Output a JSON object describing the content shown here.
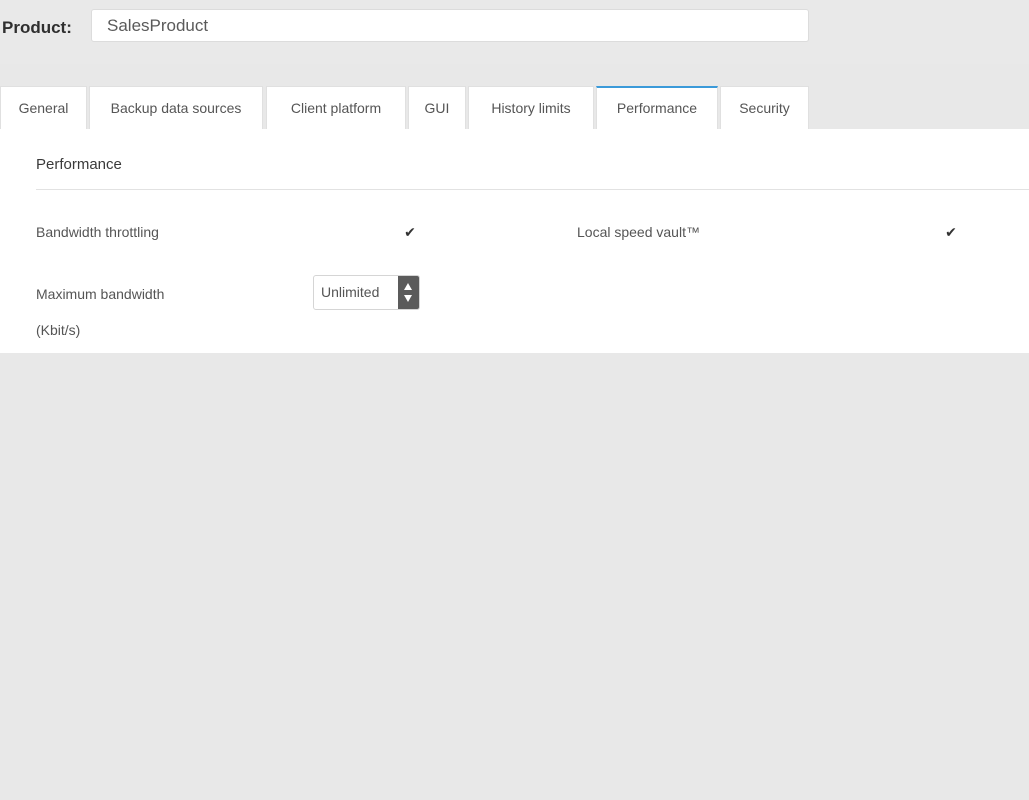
{
  "header": {
    "product_label": "Product:",
    "product_value": "SalesProduct"
  },
  "tabs": [
    {
      "label": "General",
      "active": false
    },
    {
      "label": "Backup data sources",
      "active": false
    },
    {
      "label": "Client platform",
      "active": false
    },
    {
      "label": "GUI",
      "active": false
    },
    {
      "label": "History limits",
      "active": false
    },
    {
      "label": "Performance",
      "active": true
    },
    {
      "label": "Security",
      "active": false
    }
  ],
  "panel": {
    "title": "Performance",
    "bandwidth_throttling": {
      "label": "Bandwidth throttling",
      "checked": true
    },
    "local_speed_vault": {
      "label": "Local speed vault™",
      "checked": true
    },
    "maximum_bandwidth": {
      "label": "Maximum bandwidth",
      "unit": "(Kbit/s)",
      "value": "Unlimited"
    }
  },
  "colors": {
    "accent": "#3b9ad9",
    "background": "#e8e8e8",
    "panel": "#ffffff",
    "stepper_button": "#5b5b5b"
  },
  "icons": {
    "checkmark": "check-icon",
    "spin_up": "arrow-up-icon",
    "spin_down": "arrow-down-icon"
  }
}
